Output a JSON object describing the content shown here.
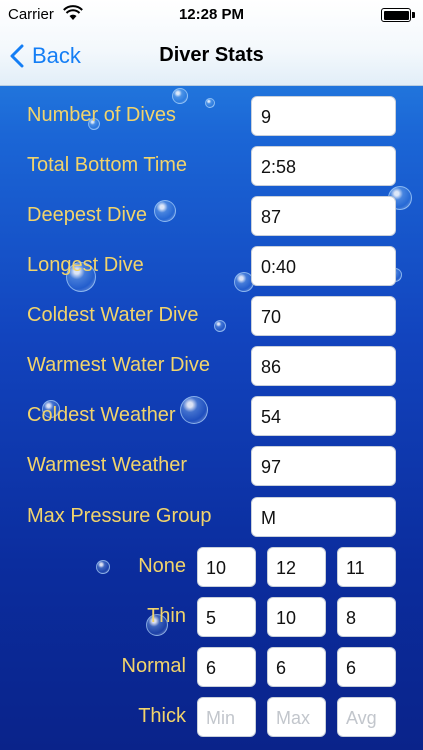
{
  "status_bar": {
    "carrier": "Carrier",
    "time": "12:28 PM"
  },
  "nav": {
    "back_label": "Back",
    "title": "Diver Stats"
  },
  "stats": [
    {
      "label": "Number of Dives",
      "value": "9"
    },
    {
      "label": "Total Bottom Time",
      "value": "2:58"
    },
    {
      "label": "Deepest Dive",
      "value": "87"
    },
    {
      "label": "Longest Dive",
      "value": "0:40"
    },
    {
      "label": "Coldest Water Dive",
      "value": "70"
    },
    {
      "label": "Warmest Water Dive",
      "value": "86"
    },
    {
      "label": "Coldest Weather",
      "value": "54"
    },
    {
      "label": "Warmest Weather",
      "value": "97"
    },
    {
      "label": "Max Pressure Group",
      "value": "M"
    }
  ],
  "suits": [
    {
      "label": "None",
      "min": "10",
      "max": "12",
      "avg": "11"
    },
    {
      "label": "Thin",
      "min": "5",
      "max": "10",
      "avg": "8"
    },
    {
      "label": "Normal",
      "min": "6",
      "max": "6",
      "avg": "6"
    },
    {
      "label": "Thick",
      "min": "",
      "max": "",
      "avg": ""
    }
  ],
  "placeholders": {
    "min": "Min",
    "max": "Max",
    "avg": "Avg"
  },
  "colors": {
    "label": "#f2d46b",
    "accent": "#147ef5",
    "background": "#1244be"
  }
}
